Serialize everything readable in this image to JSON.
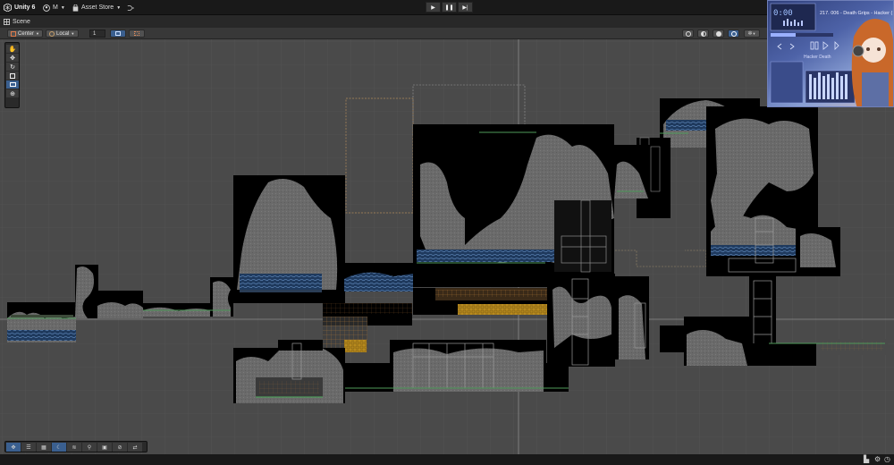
{
  "topbar": {
    "app_name": "Unity 6",
    "account_label": "M",
    "asset_store_label": "Asset Store"
  },
  "tabs": {
    "scene_label": "Scene"
  },
  "scene_toolbar": {
    "pivot_mode": "Center",
    "pivot_rotation": "Local",
    "grid_increment": "1"
  },
  "media_player": {
    "track_text": "217. 006 - Death Grips - Hacker (",
    "subtitle": "Hacker Death"
  },
  "colors": {
    "viewport_bg": "#4a4a4a",
    "accent_blue": "#3a5f8f",
    "tile_dark": "#000000",
    "tile_gray": "#6b6b6b",
    "water_blue": "#2b4f7a",
    "highlight_orange": "#c9962a"
  }
}
